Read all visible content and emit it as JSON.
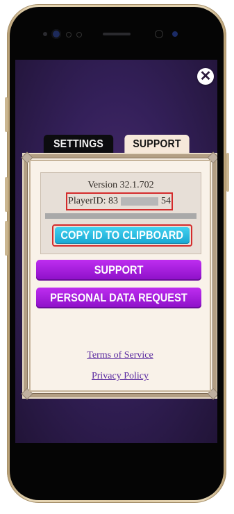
{
  "screen": {
    "close_glyph": "✕",
    "tabs": [
      {
        "label": "SETTINGS",
        "active": false
      },
      {
        "label": "SUPPORT",
        "active": true
      }
    ],
    "info": {
      "version": "Version 32.1.702",
      "player_id_prefix": "PlayerID: 83",
      "player_id_suffix": "54"
    },
    "buttons": {
      "copy_id": "COPY ID TO CLIPBOARD",
      "support": "SUPPORT",
      "personal_data": "PERSONAL DATA REQUEST"
    },
    "links": {
      "terms": "Terms of Service",
      "privacy": "Privacy Policy"
    }
  },
  "colors": {
    "background": "#34205a",
    "cyan_button": "#17a6d2",
    "purple_button": "#8c10c7",
    "highlight_border": "#d42b2b",
    "link": "#5a2aa0"
  },
  "icons": [
    "close-icon"
  ]
}
